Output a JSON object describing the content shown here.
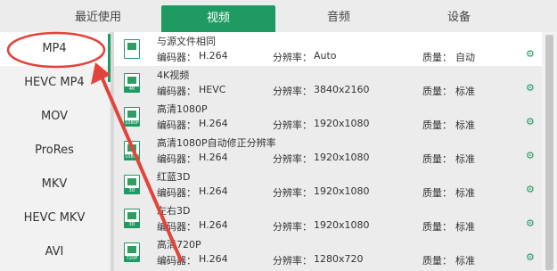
{
  "tabs": [
    "最近使用",
    "视频",
    "音频",
    "设备"
  ],
  "sidebar": [
    "MP4",
    "HEVC MP4",
    "MOV",
    "ProRes",
    "MKV",
    "HEVC MKV",
    "AVI"
  ],
  "labels": {
    "encoder": "编码器：",
    "resolution": "分辨率：",
    "quality": "质量："
  },
  "rows": [
    {
      "name": "与源文件相同",
      "encoder": "H.264",
      "resolution": "Auto",
      "quality": "自动",
      "badge": "",
      "icon": "film-icon"
    },
    {
      "name": "4K视频",
      "encoder": "HEVC",
      "resolution": "3840x2160",
      "quality": "标准",
      "badge": "4K",
      "icon": "4k-icon"
    },
    {
      "name": "高清1080P",
      "encoder": "H.264",
      "resolution": "1920x1080",
      "quality": "标准",
      "badge": "1080P",
      "icon": "1080p-icon"
    },
    {
      "name": "高清1080P自动修正分辨率",
      "encoder": "H.264",
      "resolution": "1920x1080",
      "quality": "标准",
      "badge": "1080P",
      "icon": "1080p-icon"
    },
    {
      "name": "红蓝3D",
      "encoder": "H.264",
      "resolution": "1920x1080",
      "quality": "标准",
      "badge": "3D",
      "icon": "3d-icon"
    },
    {
      "name": "左右3D",
      "encoder": "H.264",
      "resolution": "1920x1080",
      "quality": "标准",
      "badge": "3D",
      "icon": "3d-icon"
    },
    {
      "name": "高清720P",
      "encoder": "H.264",
      "resolution": "1280x720",
      "quality": "标准",
      "badge": "720P",
      "icon": "720p-icon"
    }
  ],
  "colors": {
    "accent": "#1f9a63",
    "annotation": "#e2433a"
  }
}
